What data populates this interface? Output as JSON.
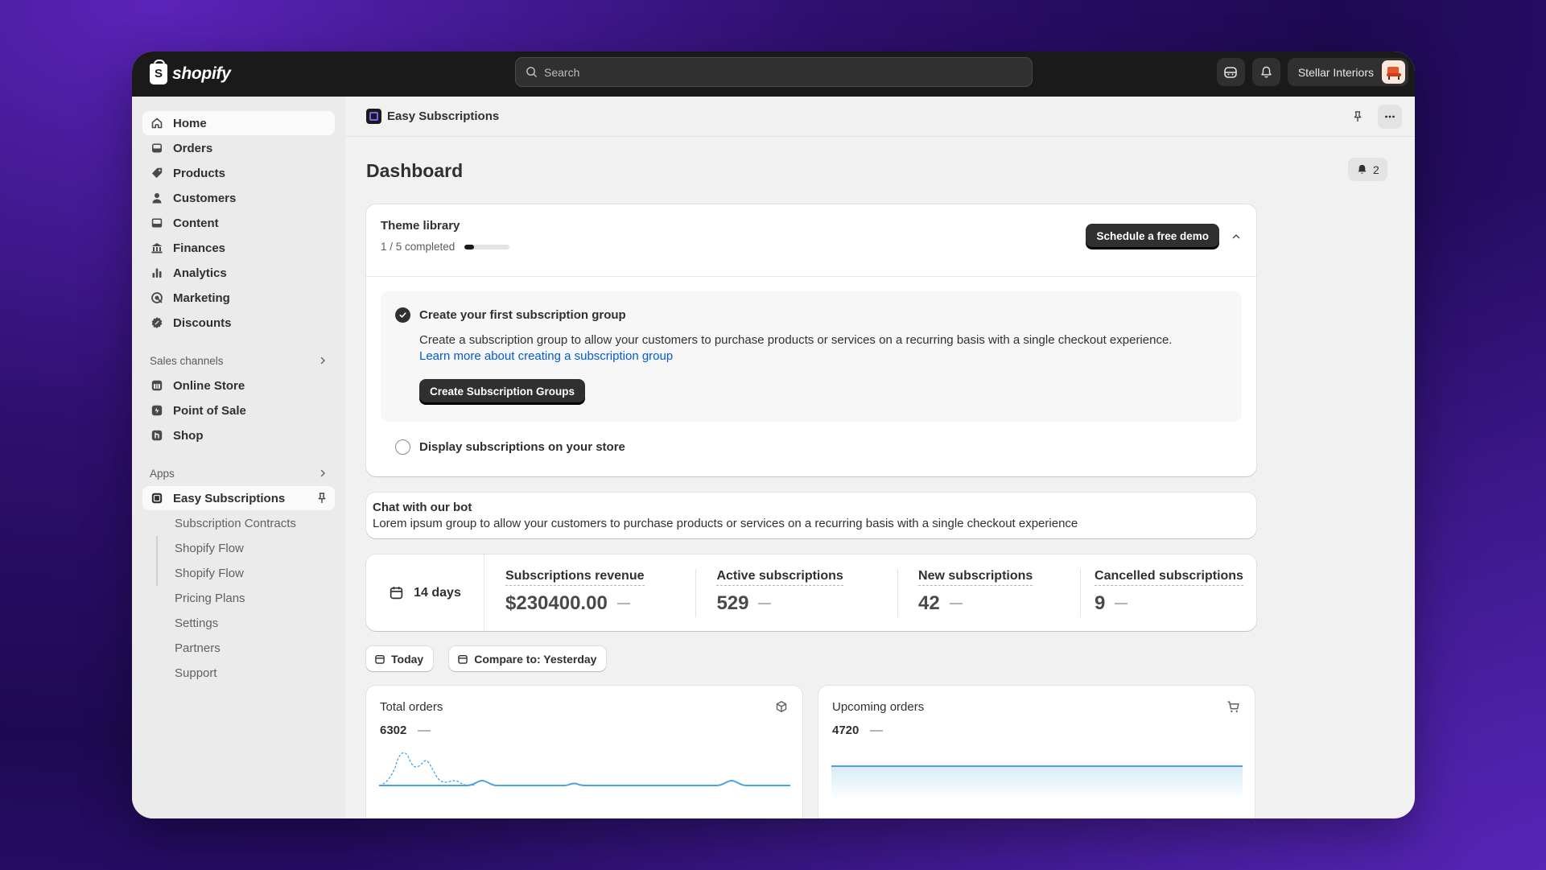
{
  "topbar": {
    "brand": "shopify",
    "search_placeholder": "Search",
    "store_name": "Stellar Interiors"
  },
  "sidebar": {
    "items": [
      {
        "label": "Home",
        "icon": "home-icon"
      },
      {
        "label": "Orders",
        "icon": "inbox-icon"
      },
      {
        "label": "Products",
        "icon": "tag-icon"
      },
      {
        "label": "Customers",
        "icon": "person-icon"
      },
      {
        "label": "Content",
        "icon": "image-icon"
      },
      {
        "label": "Finances",
        "icon": "bank-icon"
      },
      {
        "label": "Analytics",
        "icon": "bar-chart-icon"
      },
      {
        "label": "Marketing",
        "icon": "target-icon"
      },
      {
        "label": "Discounts",
        "icon": "discount-icon"
      }
    ],
    "sales_channels_label": "Sales channels",
    "channels": [
      {
        "label": "Online Store",
        "icon": "store-icon"
      },
      {
        "label": "Point of Sale",
        "icon": "pos-icon"
      },
      {
        "label": "Shop",
        "icon": "shop-icon"
      }
    ],
    "apps_label": "Apps",
    "app_name": "Easy Subscriptions",
    "app_subitems": [
      "Subscription Contracts",
      "Shopify Flow",
      "Shopify Flow",
      "Pricing Plans",
      "Settings",
      "Partners",
      "Support"
    ]
  },
  "appbar": {
    "title": "Easy Subscriptions"
  },
  "page": {
    "title": "Dashboard",
    "notification_count": "2"
  },
  "theme_library": {
    "title": "Theme library",
    "progress_text": "1 / 5 completed",
    "progress_fraction": 0.2,
    "demo_button": "Schedule a free demo",
    "task1": {
      "title": "Create your first subscription group",
      "description": "Create a subscription group to allow your customers to purchase products or services on a recurring basis with a single checkout experience.",
      "link": "Learn more about creating a subscription group",
      "button": "Create Subscription Groups"
    },
    "task2": {
      "title": "Display subscriptions on your store"
    }
  },
  "bot": {
    "title": "Chat with our bot",
    "text": "Lorem ipsum group to allow your customers to purchase products or services on a recurring basis with a single checkout experience"
  },
  "stats": {
    "range": "14 days",
    "items": [
      {
        "label": "Subscriptions revenue",
        "value": "$230400.00"
      },
      {
        "label": "Active subscriptions",
        "value": "529"
      },
      {
        "label": "New subscriptions",
        "value": "42"
      },
      {
        "label": "Cancelled subscriptions",
        "value": "9"
      }
    ]
  },
  "filters": {
    "today": "Today",
    "compare": "Compare to: Yesterday"
  },
  "charts": {
    "total_orders": {
      "title": "Total orders",
      "value": "6302"
    },
    "upcoming_orders": {
      "title": "Upcoming orders",
      "value": "4720"
    }
  },
  "colors": {
    "accent_link": "#005bd3",
    "chart_line": "#4aa3df",
    "topbar": "#1a1a1a",
    "app_icon_border": "#8a5cf6"
  }
}
